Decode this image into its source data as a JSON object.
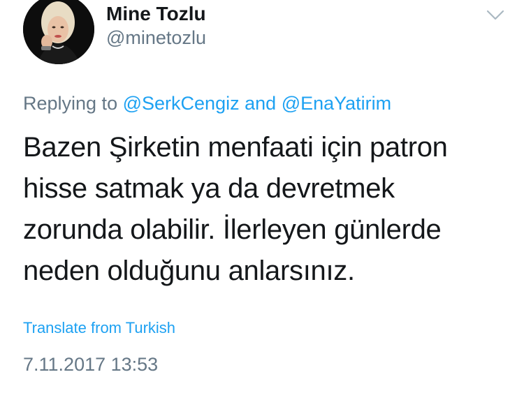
{
  "tweet": {
    "author": {
      "display_name": "Mine Tozlu",
      "handle": "@minetozlu"
    },
    "reply": {
      "prefix": "Replying to",
      "mention_1": "@SerkCengiz",
      "conjunction": "and",
      "mention_2": "@EnaYatirim"
    },
    "text_lines": [
      "Bazen Şirketin menfaati için patron",
      "hisse satmak ya da devretmek",
      "zorunda olabilir. İlerleyen günlerde",
      "neden olduğunu anlarsınız."
    ],
    "translate_label": "Translate from Turkish",
    "timestamp": "7.11.2017 13:53"
  },
  "icons": {
    "avatar": "profile-photo",
    "menu": "chevron-down-icon"
  },
  "colors": {
    "text": "#14171a",
    "secondary": "#657786",
    "link": "#1da1f2",
    "background": "#ffffff"
  }
}
